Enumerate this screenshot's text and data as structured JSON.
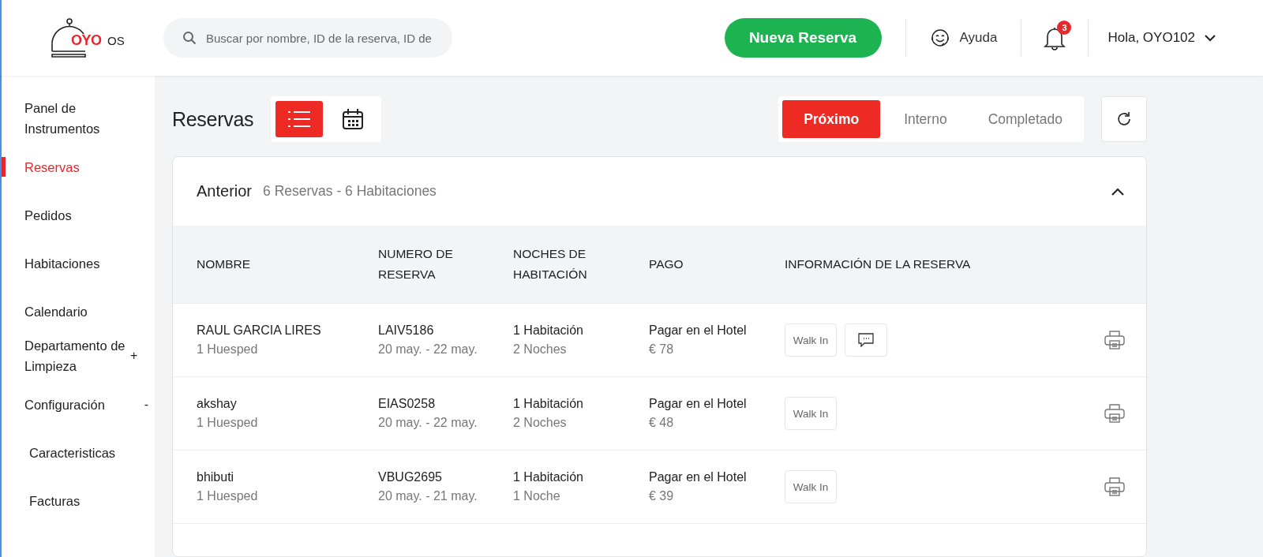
{
  "header": {
    "logo": {
      "brand": "OYO",
      "suffix": "OS"
    },
    "search": {
      "placeholder": "Buscar por nombre, ID de la reserva, ID de"
    },
    "new_button": "Nueva Reserva",
    "help": "Ayuda",
    "notifications": {
      "count": "3"
    },
    "user": "Hola, OYO102"
  },
  "sidebar": {
    "items": [
      {
        "label": "Panel de Instrumentos",
        "selected": false
      },
      {
        "label": "Reservas",
        "selected": true
      },
      {
        "label": "Pedidos",
        "selected": false
      },
      {
        "label": "Habitaciones",
        "selected": false
      },
      {
        "label": "Calendario",
        "selected": false
      },
      {
        "label": "Departamento de Limpieza",
        "selected": false,
        "toggle": "+"
      },
      {
        "label": "Configuración",
        "selected": false,
        "toggle": "-",
        "children": [
          {
            "label": "Caracteristicas",
            "selected": false
          },
          {
            "label": "Facturas",
            "selected": false
          }
        ]
      }
    ]
  },
  "page": {
    "title": "Reservas",
    "views": [
      {
        "kind": "list",
        "selected": true
      },
      {
        "kind": "calendar",
        "selected": false
      }
    ],
    "tabs": [
      {
        "label": "Próximo",
        "selected": true
      },
      {
        "label": "Interno",
        "selected": false
      },
      {
        "label": "Completado",
        "selected": false
      }
    ]
  },
  "section": {
    "title": "Anterior",
    "summary": "6 Reservas - 6 Habitaciones",
    "expanded": true
  },
  "table": {
    "columns": [
      "NOMBRE",
      "NUMERO DE RESERVA",
      "NOCHES DE HABITACIÓN",
      "PAGO",
      "INFORMACIÓN DE LA RESERVA"
    ],
    "rows": [
      {
        "name": "RAUL GARCIA LIRES",
        "guests": "1 Huesped",
        "booking": "LAIV5186",
        "dates": "20 may. - 22 may.",
        "rooms": "1 Habitación",
        "nights": "2 Noches",
        "payment": "Pagar en el Hotel",
        "amount": "€ 78",
        "tag": "Walk In",
        "comment": true
      },
      {
        "name": "akshay",
        "guests": "1 Huesped",
        "booking": "EIAS0258",
        "dates": "20 may. - 22 may.",
        "rooms": "1 Habitación",
        "nights": "2 Noches",
        "payment": "Pagar en el Hotel",
        "amount": "€ 48",
        "tag": "Walk In",
        "comment": false
      },
      {
        "name": "bhibuti",
        "guests": "1 Huesped",
        "booking": "VBUG2695",
        "dates": "20 may. - 21 may.",
        "rooms": "1 Habitación",
        "nights": "1 Noche",
        "payment": "Pagar en el Hotel",
        "amount": "€ 39",
        "tag": "Walk In",
        "comment": false
      }
    ]
  }
}
